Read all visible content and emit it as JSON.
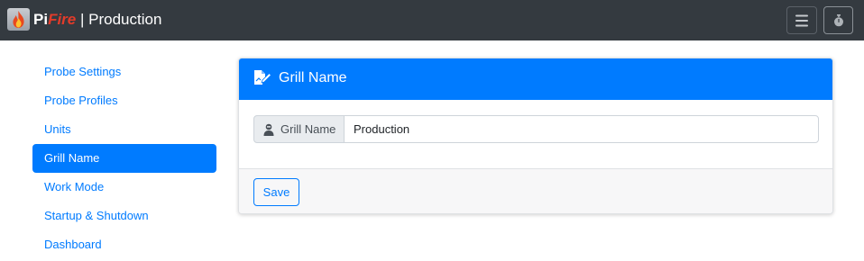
{
  "app": {
    "brand_pi": "Pi",
    "brand_fire": "Fire",
    "brand_separator": "|",
    "grill_name": "Production",
    "logo_icon": "flame-icon",
    "colors": {
      "navbar": "#343a40",
      "primary": "#007bff",
      "fire": "#e23b2a"
    }
  },
  "navbar": {
    "menu_icon": "hamburger-icon",
    "timer_icon": "stopwatch-icon"
  },
  "sidebar": {
    "items": [
      {
        "label": "Probe Settings",
        "active": false
      },
      {
        "label": "Probe Profiles",
        "active": false
      },
      {
        "label": "Units",
        "active": false
      },
      {
        "label": "Grill Name",
        "active": true
      },
      {
        "label": "Work Mode",
        "active": false
      },
      {
        "label": "Startup & Shutdown",
        "active": false
      },
      {
        "label": "Dashboard",
        "active": false
      }
    ]
  },
  "card": {
    "header_icon": "edit-file-icon",
    "title": "Grill Name",
    "field": {
      "icon": "user-icon",
      "label": "Grill Name",
      "value": "Production"
    },
    "save_label": "Save"
  }
}
